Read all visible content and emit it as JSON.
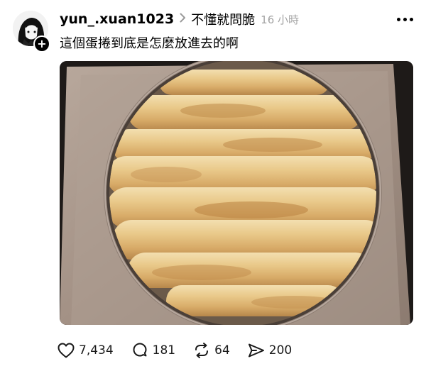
{
  "post": {
    "username": "yun_.xuan1023",
    "topic": "不懂就問脆",
    "time": "16 小時",
    "text": "這個蛋捲到底是怎麼放進去的啊",
    "follow_symbol": "+"
  },
  "actions": {
    "likes": "7,434",
    "replies": "181",
    "reposts": "64",
    "shares": "200"
  },
  "icons": {
    "chevron": "chevron-right-icon",
    "more": "more-horizontal-icon",
    "like": "heart-icon",
    "reply": "comment-bubble-icon",
    "repost": "repost-arrows-icon",
    "share": "send-icon"
  },
  "colors": {
    "text": "#000000",
    "muted": "#a3a3a3",
    "tin": "#a8968a",
    "roll": "#e6c588"
  }
}
